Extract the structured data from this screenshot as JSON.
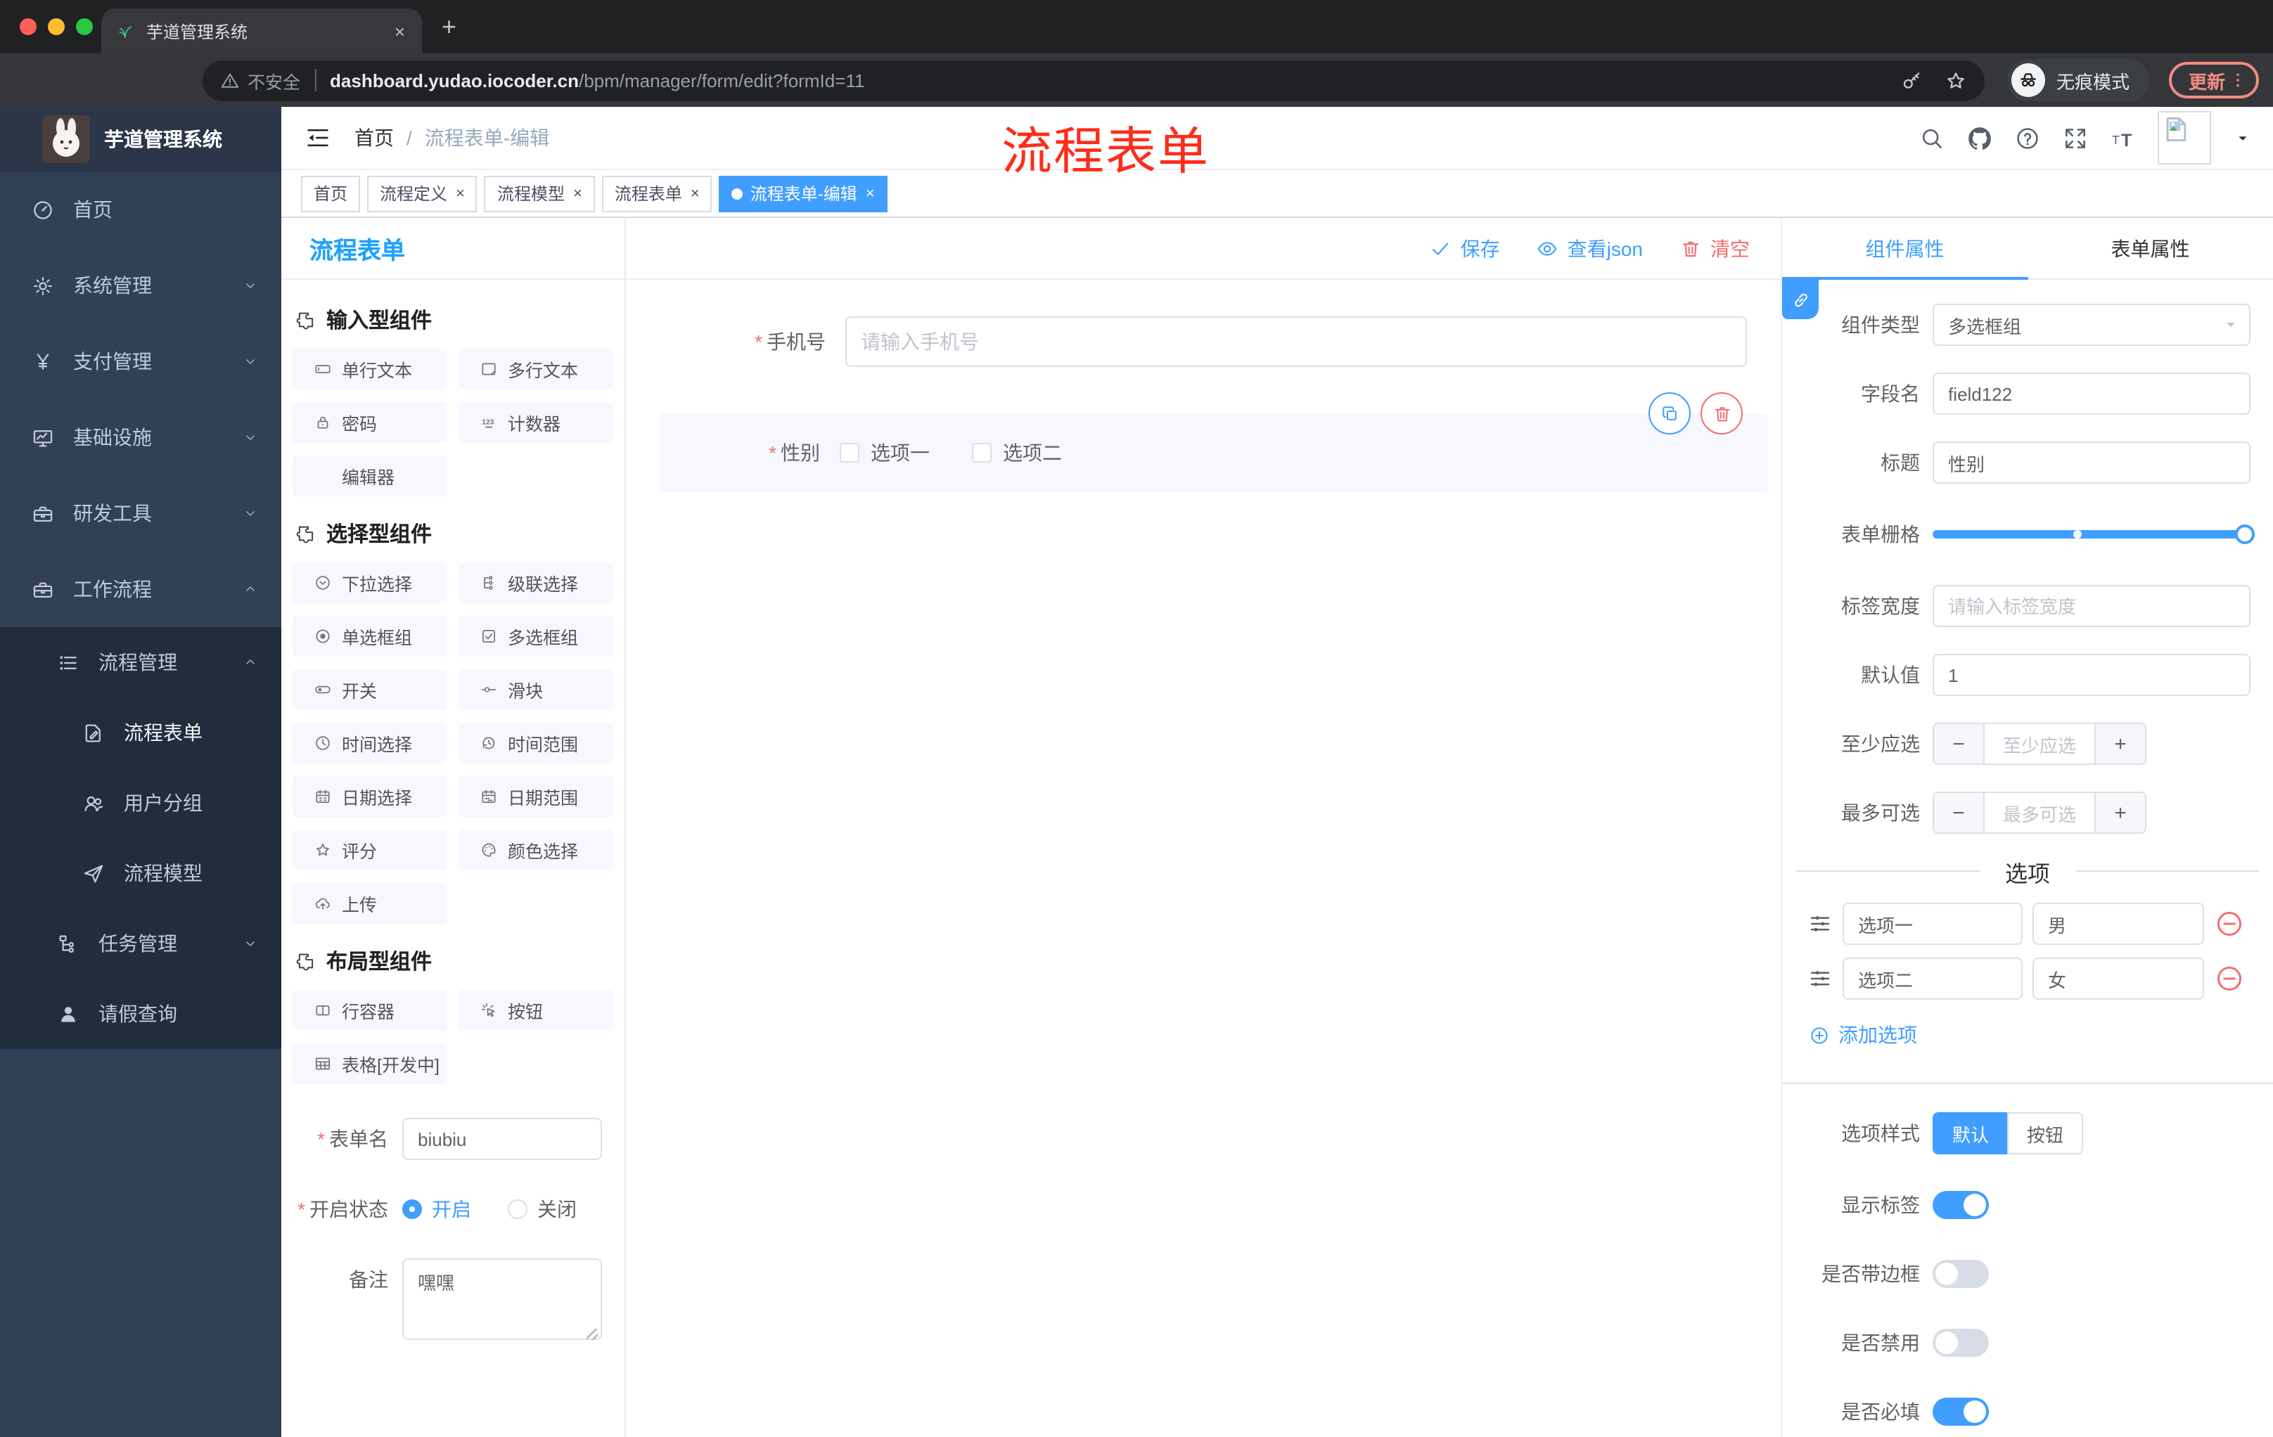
{
  "colors": {
    "primary": "#409eff",
    "danger": "#f56c6c",
    "annotation_red": "#fe2c19",
    "sidebar_bg": "#304156",
    "submenu_bg": "#1f2d3d",
    "palette_title_blue": "#1ea2ff"
  },
  "browser": {
    "tab": {
      "title": "芋道管理系统",
      "favicon": "leaf-icon",
      "close": "×"
    },
    "address": {
      "security_label": "不安全",
      "domain": "dashboard.yudao.iocoder.cn",
      "path": "/bpm/manager/form/edit?formId=11"
    },
    "incognito_label": "无痕模式",
    "update_label": "更新"
  },
  "annotation": {
    "text": "流程表单"
  },
  "sidebar": {
    "logo_title": "芋道管理系统",
    "menu": [
      {
        "name": "home",
        "icon": "dashboard",
        "label": "首页",
        "level": 1
      },
      {
        "name": "system-mgmt",
        "icon": "gear",
        "label": "系统管理",
        "level": 1,
        "chevron": "down"
      },
      {
        "name": "payment-mgmt",
        "icon": "yen",
        "label": "支付管理",
        "level": 1,
        "chevron": "down"
      },
      {
        "name": "infrastructure",
        "icon": "monitor",
        "label": "基础设施",
        "level": 1,
        "chevron": "down"
      },
      {
        "name": "dev-tools",
        "icon": "toolbox",
        "label": "研发工具",
        "level": 1,
        "chevron": "down"
      },
      {
        "name": "workflow",
        "icon": "toolbox",
        "label": "工作流程",
        "level": 1,
        "chevron": "up"
      },
      {
        "name": "process-mgmt",
        "icon": "list",
        "label": "流程管理",
        "level": 2,
        "chevron": "up",
        "dark": true
      },
      {
        "name": "process-form",
        "icon": "doc-edit",
        "label": "流程表单",
        "level": 3,
        "dark": true,
        "active": true
      },
      {
        "name": "user-group",
        "icon": "users",
        "label": "用户分组",
        "level": 3,
        "dark": true
      },
      {
        "name": "process-model",
        "icon": "plane",
        "label": "流程模型",
        "level": 3,
        "dark": true
      },
      {
        "name": "task-mgmt",
        "icon": "tree",
        "label": "任务管理",
        "level": 2,
        "chevron": "down",
        "dark": true
      },
      {
        "name": "leave-query",
        "icon": "person",
        "label": "请假查询",
        "level": 2,
        "dark": true
      }
    ]
  },
  "header": {
    "breadcrumb": {
      "home": "首页",
      "sep": "/",
      "current": "流程表单-编辑"
    },
    "icons": [
      {
        "name": "search-icon",
        "icon": "search"
      },
      {
        "name": "github-icon",
        "icon": "github"
      },
      {
        "name": "help-icon",
        "icon": "question"
      },
      {
        "name": "fullscreen-icon",
        "icon": "fullscreen"
      },
      {
        "name": "font-size-icon",
        "icon": "textsize"
      }
    ]
  },
  "tags": [
    {
      "name": "tag-home",
      "label": "首页",
      "closable": false,
      "active": false
    },
    {
      "name": "tag-process-definition",
      "label": "流程定义",
      "closable": true,
      "active": false
    },
    {
      "name": "tag-process-model",
      "label": "流程模型",
      "closable": true,
      "active": false
    },
    {
      "name": "tag-process-form",
      "label": "流程表单",
      "closable": true,
      "active": false
    },
    {
      "name": "tag-process-form-edit",
      "label": "流程表单-编辑",
      "closable": true,
      "active": true
    }
  ],
  "palette": {
    "title": "流程表单",
    "sections": [
      {
        "name": "input-components",
        "icon": "puzzle",
        "title": "输入型组件",
        "items": [
          {
            "name": "single-line-text",
            "icon": "input",
            "label": "单行文本"
          },
          {
            "name": "multi-line-text",
            "icon": "textarea",
            "label": "多行文本"
          },
          {
            "name": "password",
            "icon": "lock",
            "label": "密码"
          },
          {
            "name": "counter",
            "icon": "counter",
            "label": "计数器"
          },
          {
            "name": "editor",
            "icon": null,
            "label": "编辑器"
          }
        ]
      },
      {
        "name": "select-components",
        "icon": "puzzle",
        "title": "选择型组件",
        "items": [
          {
            "name": "select",
            "icon": "select",
            "label": "下拉选择"
          },
          {
            "name": "cascader",
            "icon": "cascade",
            "label": "级联选择"
          },
          {
            "name": "radio-group",
            "icon": "radio",
            "label": "单选框组"
          },
          {
            "name": "checkbox-group",
            "icon": "checkbox",
            "label": "多选框组"
          },
          {
            "name": "switch",
            "icon": "switch",
            "label": "开关"
          },
          {
            "name": "slider",
            "icon": "slider",
            "label": "滑块"
          },
          {
            "name": "time-picker",
            "icon": "time",
            "label": "时间选择"
          },
          {
            "name": "time-range",
            "icon": "timerange",
            "label": "时间范围"
          },
          {
            "name": "date-picker",
            "icon": "date",
            "label": "日期选择"
          },
          {
            "name": "date-range",
            "icon": "daterange",
            "label": "日期范围"
          },
          {
            "name": "rate",
            "icon": "star",
            "label": "评分"
          },
          {
            "name": "color-picker",
            "icon": "palette",
            "label": "颜色选择"
          },
          {
            "name": "upload",
            "icon": "upload",
            "label": "上传"
          }
        ]
      },
      {
        "name": "layout-components",
        "icon": "puzzle",
        "title": "布局型组件",
        "items": [
          {
            "name": "row-container",
            "icon": "row",
            "label": "行容器"
          },
          {
            "name": "button",
            "icon": "pointer",
            "label": "按钮"
          },
          {
            "name": "table-dev",
            "icon": "table",
            "label": "表格[开发中]"
          }
        ]
      }
    ],
    "form": {
      "name_label": "表单名",
      "name_value": "biubiu",
      "status_label": "开启状态",
      "status_options": [
        {
          "label": "开启",
          "selected": true
        },
        {
          "label": "关闭",
          "selected": false
        }
      ],
      "remark_label": "备注",
      "remark_value": "嘿嘿"
    }
  },
  "canvas": {
    "toolbar": {
      "save": "保存",
      "view_json": "查看json",
      "clear": "清空"
    },
    "phone": {
      "label": "手机号",
      "required": true,
      "placeholder": "请输入手机号"
    },
    "gender": {
      "label": "性别",
      "required": true,
      "options": [
        {
          "label": "选项一",
          "checked": false
        },
        {
          "label": "选项二",
          "checked": false
        }
      ]
    }
  },
  "inspector": {
    "tabs": {
      "component": "组件属性",
      "form": "表单属性"
    },
    "component_type": {
      "label": "组件类型",
      "value": "多选框组"
    },
    "field_name": {
      "label": "字段名",
      "value": "field122"
    },
    "title": {
      "label": "标题",
      "value": "性别"
    },
    "form_grid": {
      "label": "表单栅格",
      "stop_percent": 47,
      "value_percent": 100
    },
    "label_width": {
      "label": "标签宽度",
      "placeholder": "请输入标签宽度"
    },
    "default_value": {
      "label": "默认值",
      "value": "1"
    },
    "min_select": {
      "label": "至少应选",
      "placeholder": "至少应选"
    },
    "max_select": {
      "label": "最多可选",
      "placeholder": "最多可选"
    },
    "options_divider": "选项",
    "options": [
      {
        "label": "选项一",
        "value": "男"
      },
      {
        "label": "选项二",
        "value": "女"
      }
    ],
    "add_option": "添加选项",
    "option_style": {
      "label": "选项样式",
      "choices": [
        "默认",
        "按钮"
      ],
      "selected": 0
    },
    "switches": [
      {
        "name": "show-label",
        "label": "显示标签",
        "on": true
      },
      {
        "name": "with-border",
        "label": "是否带边框",
        "on": false
      },
      {
        "name": "disabled",
        "label": "是否禁用",
        "on": false
      },
      {
        "name": "required",
        "label": "是否必填",
        "on": true
      }
    ]
  }
}
